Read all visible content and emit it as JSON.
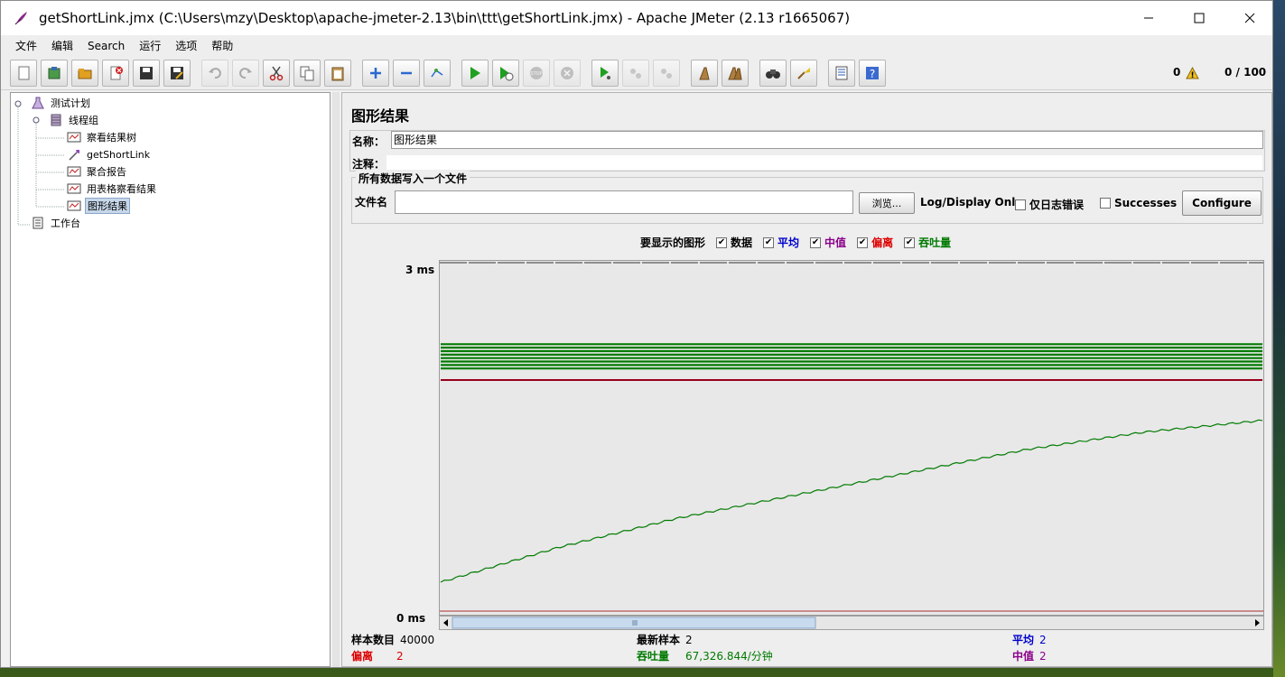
{
  "window": {
    "title": "getShortLink.jmx (C:\\Users\\mzy\\Desktop\\apache-jmeter-2.13\\bin\\ttt\\getShortLink.jmx) - Apache JMeter (2.13 r1665067)"
  },
  "menu": [
    "文件",
    "编辑",
    "Search",
    "运行",
    "选项",
    "帮助"
  ],
  "toolbar": {
    "warnings": "0",
    "threads": "0 / 100",
    "icons": [
      "new-icon",
      "templates-icon",
      "open-icon",
      "close-icon",
      "save-icon",
      "save-as-icon",
      "undo-icon",
      "redo-icon",
      "cut-icon",
      "copy-icon",
      "paste-icon",
      "expand-icon",
      "collapse-icon",
      "toggle-icon",
      "start-icon",
      "start-no-pause-icon",
      "stop-icon",
      "shutdown-icon",
      "remote-start-icon",
      "remote-stop-icon",
      "remote-shutdown-icon",
      "clear-icon",
      "clear-all-icon",
      "search-icon",
      "reset-search-icon",
      "function-helper-icon",
      "help-icon"
    ]
  },
  "tree": {
    "items": [
      {
        "label": "测试计划",
        "icon": "test-plan-icon"
      },
      {
        "label": "线程组",
        "icon": "thread-group-icon"
      },
      {
        "label": "察看结果树",
        "icon": "listener-icon"
      },
      {
        "label": "getShortLink",
        "icon": "http-sampler-icon"
      },
      {
        "label": "聚合报告",
        "icon": "listener-icon"
      },
      {
        "label": "用表格察看结果",
        "icon": "listener-icon"
      },
      {
        "label": "图形结果",
        "icon": "listener-icon"
      },
      {
        "label": "工作台",
        "icon": "workbench-icon"
      }
    ]
  },
  "panel": {
    "title": "图形结果",
    "name_label": "名称：",
    "name_value": "图形结果",
    "comment_label": "注释：",
    "comment_value": "",
    "file_section": "所有数据写入一个文件",
    "filename_label": "文件名",
    "filename_value": "",
    "browse": "浏览...",
    "log_display_only": "Log/Display Only:",
    "errors_only": "仅日志错误",
    "successes": "Successes",
    "configure": "Configure"
  },
  "graph_options": {
    "label": "要显示的图形",
    "options": [
      {
        "label": "数据",
        "checked": true,
        "color": "#000000"
      },
      {
        "label": "平均",
        "checked": true,
        "color": "#0000cc"
      },
      {
        "label": "中值",
        "checked": true,
        "color": "#8b008b"
      },
      {
        "label": "偏离",
        "checked": true,
        "color": "#dd0000"
      },
      {
        "label": "吞吐量",
        "checked": true,
        "color": "#007a00"
      }
    ]
  },
  "chart": {
    "y_max_label": "3 ms",
    "y_min_label": "0 ms"
  },
  "chart_data": {
    "type": "line",
    "ylim": [
      0,
      3
    ],
    "ylabel": "ms",
    "series": [
      {
        "name": "数据",
        "color": "#000000",
        "values": [
          2,
          2,
          2,
          2,
          2,
          2,
          2,
          2
        ]
      },
      {
        "name": "平均",
        "color": "#0000cc",
        "values": [
          2,
          2,
          2,
          2,
          2,
          2,
          2,
          2
        ]
      },
      {
        "name": "中值",
        "color": "#8b008b",
        "values": [
          2,
          2,
          2,
          2,
          2,
          2,
          2,
          2
        ]
      },
      {
        "name": "偏离",
        "color": "#dd0000",
        "values": [
          2,
          2,
          2,
          2,
          2,
          2,
          2,
          2
        ]
      },
      {
        "name": "吞吐量",
        "color": "#007a00",
        "values": [
          0.25,
          0.55,
          0.8,
          1.0,
          1.2,
          1.4,
          1.55,
          1.65
        ]
      }
    ]
  },
  "stats": {
    "samples_label": "样本数目",
    "samples_value": "40000",
    "latest_label": "最新样本",
    "latest_value": "2",
    "average_label": "平均",
    "average_value": "2",
    "deviation_label": "偏离",
    "deviation_value": "2",
    "throughput_label": "吞吐量",
    "throughput_value": "67,326.844/分钟",
    "median_label": "中值",
    "median_value": "2"
  }
}
